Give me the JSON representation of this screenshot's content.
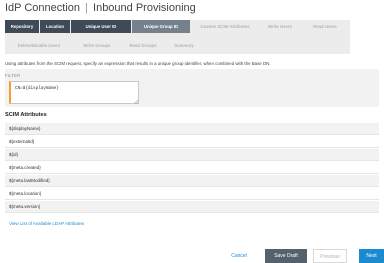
{
  "header": {
    "title_left": "IdP Connection",
    "separator": "|",
    "title_right": "Inbound Provisioning"
  },
  "tabs": [
    {
      "label": "Repository",
      "state": "done"
    },
    {
      "label": "Location",
      "state": "done"
    },
    {
      "label": "Unique User ID",
      "state": "done"
    },
    {
      "label": "Unique Group ID",
      "state": "active"
    },
    {
      "label": "Custom SCIM Attributes",
      "state": "todo"
    },
    {
      "label": "Write Users",
      "state": "todo"
    },
    {
      "label": "Read Users",
      "state": "todo"
    },
    {
      "label": "Delete/Disable Users",
      "state": "todo"
    },
    {
      "label": "Write Groups",
      "state": "todo"
    },
    {
      "label": "Read Groups",
      "state": "todo"
    },
    {
      "label": "Summary",
      "state": "todo"
    }
  ],
  "intro_text": "Using attributes from the SCIM request, specify an expression that results in a unique group identifier, when combined with the Base DN.",
  "filter": {
    "label": "FILTER",
    "value": "CN=${displayName}"
  },
  "scim_attributes": {
    "heading": "SCIM Attributes",
    "items": [
      "${displayName}",
      "${externalId}",
      "${id}",
      "${meta.created}",
      "${meta.lastModified}",
      "${meta.location}",
      "${meta.version}"
    ]
  },
  "ldap_link": "View List of Available LDAP Attributes",
  "buttons": {
    "cancel": "Cancel",
    "save_draft": "Save Draft",
    "previous": "Previous",
    "next": "Next"
  },
  "colors": {
    "tab_done": "#3e4a56",
    "tab_active": "#74808b",
    "accent_blue": "#1b8ad1",
    "filter_accent": "#f0a030"
  }
}
